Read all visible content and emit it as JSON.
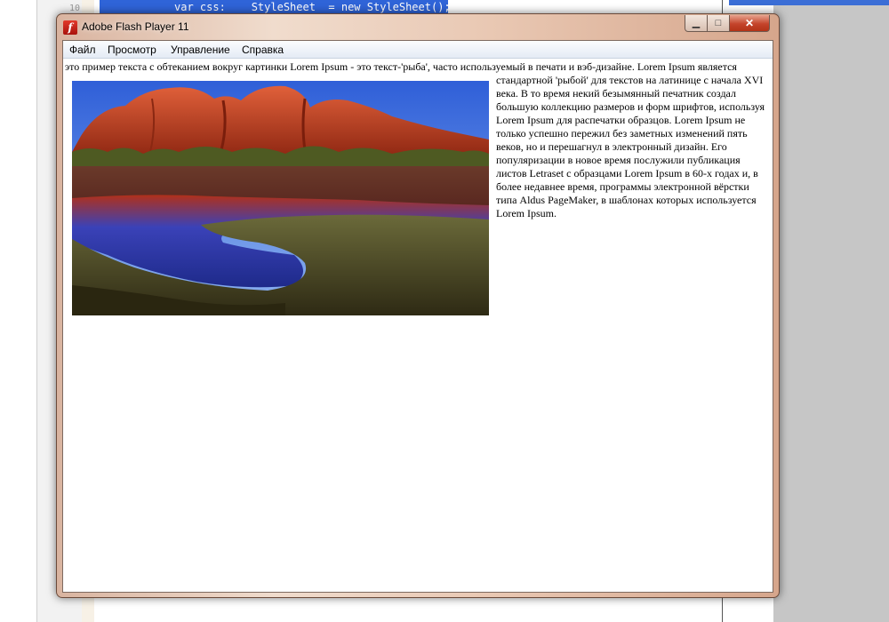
{
  "editor": {
    "line_number": "10",
    "code_line": "var css:    StyleSheet  = new StyleSheet();"
  },
  "window": {
    "title": "Adobe Flash Player 11",
    "icon": "flash-player-icon",
    "minimize_glyph": "▁",
    "maximize_glyph": "□",
    "close_glyph": "✕"
  },
  "menu": {
    "items": [
      "Файл",
      "Просмотр",
      "Управление",
      "Справка"
    ]
  },
  "content": {
    "first_line": "это пример текста с обтеканием вокруг картинки Lorem Ipsum - это текст-'рыба', часто используемый в печати и вэб-дизайне. Lorem Ipsum является",
    "wrapped_text": "стандартной 'рыбой' для текстов на латинице с начала XVI века. В то время некий безымянный печатник создал большую коллекцию размеров и форм шрифтов, используя Lorem Ipsum для распечатки образцов. Lorem Ipsum не только успешно пережил без заметных изменений пять веков, но и перешагнул в электронный дизайн. Его популяризации в новое время послужили публикация листов Letraset с образцами Lorem Ipsum в 60-х годах и, в более недавнее время, программы электронной вёрстки типа Aldus PageMaker, в шаблонах которых используется Lorem Ipsum."
  },
  "colors": {
    "sky": "#3c6fe0",
    "rock": "#c8401c",
    "water": "#2a3fb0",
    "grass": "#5a5a2a"
  }
}
